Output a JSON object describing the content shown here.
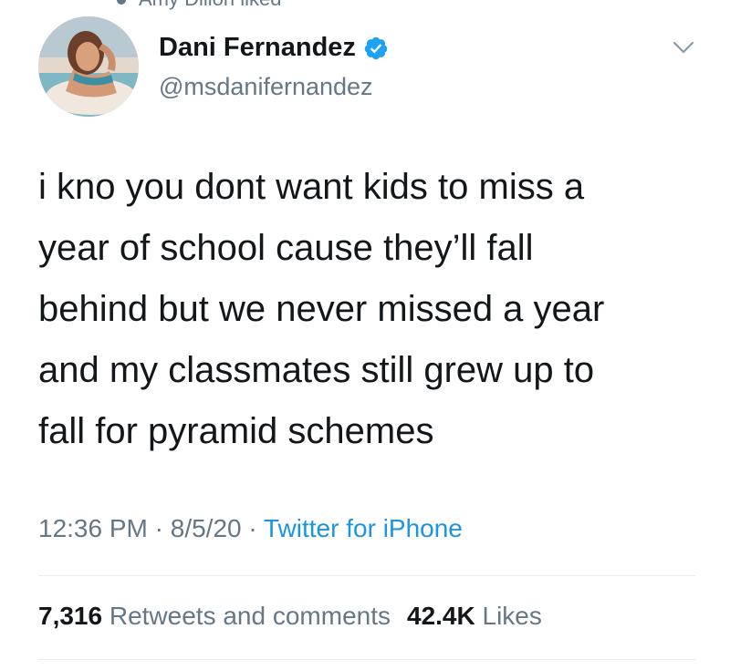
{
  "social_context": {
    "text": "Amy Dillon liked"
  },
  "author": {
    "display_name": "Dani Fernandez",
    "handle": "@msdanifernandez",
    "verified": true
  },
  "icons": {
    "avatar": "profile-photo",
    "verified": "verified-badge-icon",
    "menu": "chevron-down-icon"
  },
  "tweet": {
    "lines": [
      "i kno you dont want kids to miss a",
      "year of school cause they’ll fall",
      "behind but we never missed a year",
      "and my classmates still grew up to",
      "fall for pyramid schemes"
    ]
  },
  "meta": {
    "time": "12:36 PM",
    "sep1": " · ",
    "date": "8/5/20",
    "sep2": " · ",
    "source": "Twitter for iPhone"
  },
  "stats": {
    "retweets_count": "7,316",
    "retweets_label": "Retweets and comments",
    "likes_count": "42.4K",
    "likes_label": "Likes"
  },
  "colors": {
    "text_primary": "#14171a",
    "text_secondary": "#657786",
    "link_blue": "#1b95e0",
    "verified_blue": "#1da1f2",
    "divider": "#e6ecf0"
  }
}
